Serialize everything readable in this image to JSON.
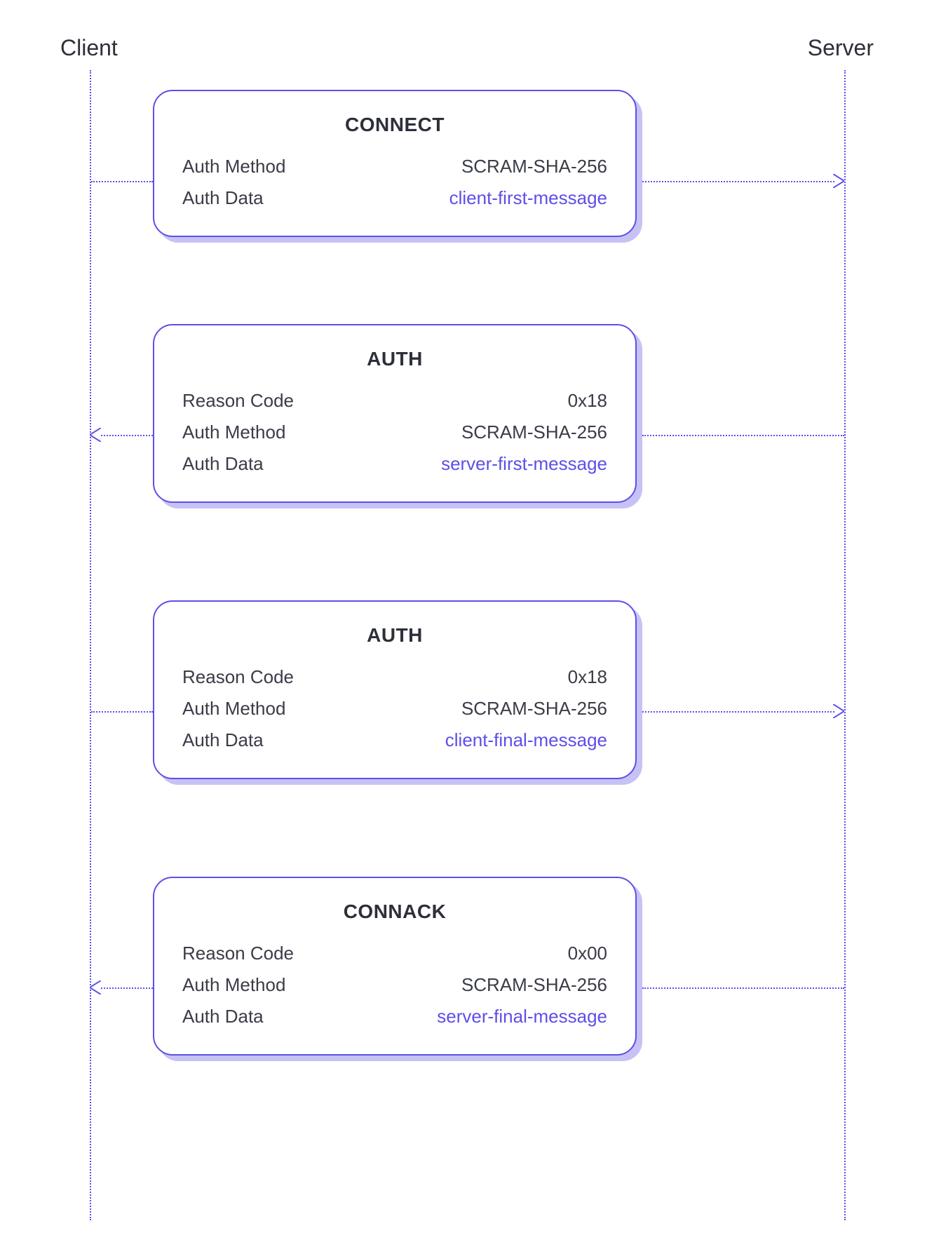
{
  "participants": {
    "client": "Client",
    "server": "Server"
  },
  "messages": [
    {
      "title": "CONNECT",
      "direction": "right",
      "fields": [
        {
          "key": "Auth Method",
          "value": "SCRAM-SHA-256",
          "link": false
        },
        {
          "key": "Auth Data",
          "value": "client-first-message",
          "link": true
        }
      ]
    },
    {
      "title": "AUTH",
      "direction": "left",
      "fields": [
        {
          "key": "Reason Code",
          "value": "0x18",
          "link": false
        },
        {
          "key": "Auth Method",
          "value": "SCRAM-SHA-256",
          "link": false
        },
        {
          "key": "Auth Data",
          "value": "server-first-message",
          "link": true
        }
      ]
    },
    {
      "title": "AUTH",
      "direction": "right",
      "fields": [
        {
          "key": "Reason Code",
          "value": "0x18",
          "link": false
        },
        {
          "key": "Auth Method",
          "value": "SCRAM-SHA-256",
          "link": false
        },
        {
          "key": "Auth Data",
          "value": "client-final-message",
          "link": true
        }
      ]
    },
    {
      "title": "CONNACK",
      "direction": "left",
      "fields": [
        {
          "key": "Reason Code",
          "value": "0x00",
          "link": false
        },
        {
          "key": "Auth Method",
          "value": "SCRAM-SHA-256",
          "link": false
        },
        {
          "key": "Auth Data",
          "value": "server-final-message",
          "link": true
        }
      ]
    }
  ]
}
